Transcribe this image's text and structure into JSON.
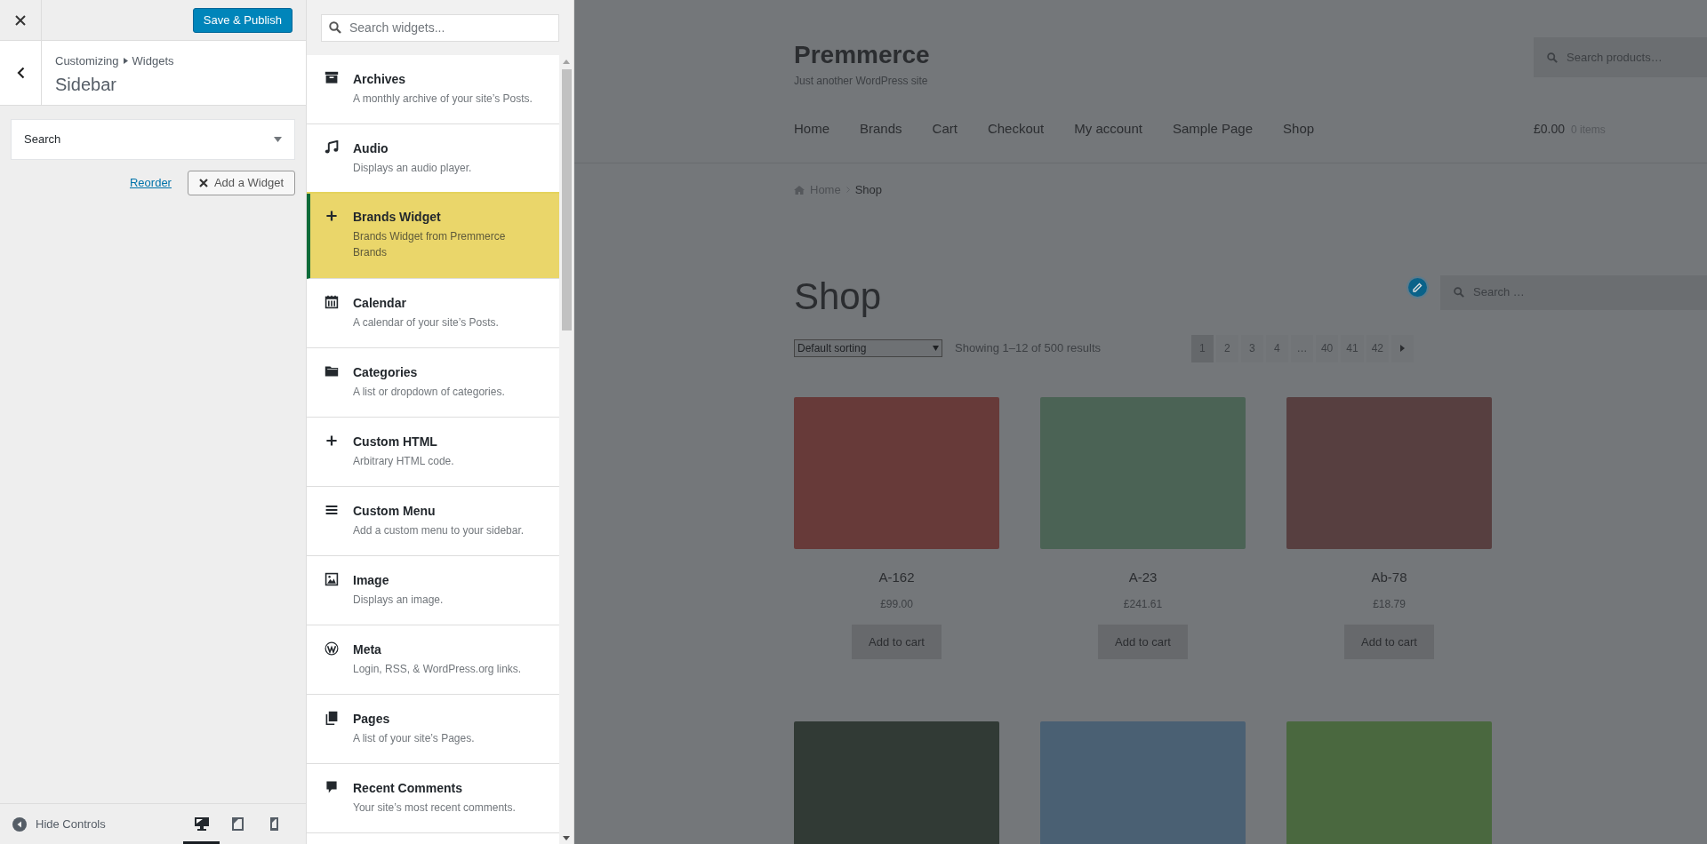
{
  "customizer": {
    "publish_button": "Save & Publish",
    "breadcrumb": [
      "Customizing",
      "Widgets"
    ],
    "section_title": "Sidebar"
  },
  "sidebar_widgets": [
    {
      "title": "Search",
      "expanded": false
    }
  ],
  "actions": {
    "reorder_link": "Reorder",
    "add_widget_button": "Add a Widget"
  },
  "footer": {
    "hide_controls": "Hide Controls",
    "devices": [
      {
        "kind": "desktop",
        "selected": true
      },
      {
        "kind": "tablet",
        "selected": false
      },
      {
        "kind": "mobile",
        "selected": false
      }
    ]
  },
  "widget_search": {
    "placeholder": "Search widgets..."
  },
  "available_widgets": [
    {
      "kind": "archive",
      "title": "Archives",
      "description": "A monthly archive of your site’s Posts.",
      "selected": false
    },
    {
      "kind": "music",
      "title": "Audio",
      "description": "Displays an audio player.",
      "selected": false
    },
    {
      "kind": "plus",
      "title": "Brands Widget",
      "description": "Brands Widget from Premmerce Brands",
      "selected": true
    },
    {
      "kind": "calendar",
      "title": "Calendar",
      "description": "A calendar of your site’s Posts.",
      "selected": false
    },
    {
      "kind": "folder",
      "title": "Categories",
      "description": "A list or dropdown of categories.",
      "selected": false
    },
    {
      "kind": "plus",
      "title": "Custom HTML",
      "description": "Arbitrary HTML code.",
      "selected": false
    },
    {
      "kind": "menu",
      "title": "Custom Menu",
      "description": "Add a custom menu to your sidebar.",
      "selected": false
    },
    {
      "kind": "image",
      "title": "Image",
      "description": "Displays an image.",
      "selected": false
    },
    {
      "kind": "logo",
      "title": "Meta",
      "description": "Login, RSS, & WordPress.org links.",
      "selected": false
    },
    {
      "kind": "pages",
      "title": "Pages",
      "description": "A list of your site’s Pages.",
      "selected": false
    },
    {
      "kind": "comment",
      "title": "Recent Comments",
      "description": "Your site’s most recent comments.",
      "selected": false
    }
  ],
  "preview": {
    "site_title": "Premmerce",
    "tagline": "Just another WordPress site",
    "product_search_placeholder": "Search products…",
    "nav": [
      "Home",
      "Brands",
      "Cart",
      "Checkout",
      "My account",
      "Sample Page",
      "Shop"
    ],
    "cart_total": "£0.00",
    "cart_count": "0 items",
    "breadcrumb": [
      "Home",
      "Shop"
    ],
    "page_title": "Shop",
    "widget_search_placeholder": "Search …",
    "sorting": "Default sorting",
    "result_count": "Showing 1–12 of 500 results",
    "pagination": [
      {
        "label": "1",
        "selected": true
      },
      {
        "label": "2",
        "selected": false
      },
      {
        "label": "3",
        "selected": false
      },
      {
        "label": "4",
        "selected": false
      },
      {
        "label": "…",
        "selected": false
      },
      {
        "label": "40",
        "selected": false
      },
      {
        "label": "41",
        "selected": false
      },
      {
        "label": "42",
        "selected": false
      }
    ],
    "products": [
      {
        "color": "#673a39",
        "name": "A-162",
        "price": "£99.00",
        "button": "Add to cart"
      },
      {
        "color": "#4b6355",
        "name": "A-23",
        "price": "£241.61",
        "button": "Add to cart"
      },
      {
        "color": "#573f40",
        "name": "Ab-78",
        "price": "£18.79",
        "button": "Add to cart"
      },
      {
        "color": "#313a35"
      },
      {
        "color": "#4a6073"
      },
      {
        "color": "#4a683f"
      }
    ]
  }
}
